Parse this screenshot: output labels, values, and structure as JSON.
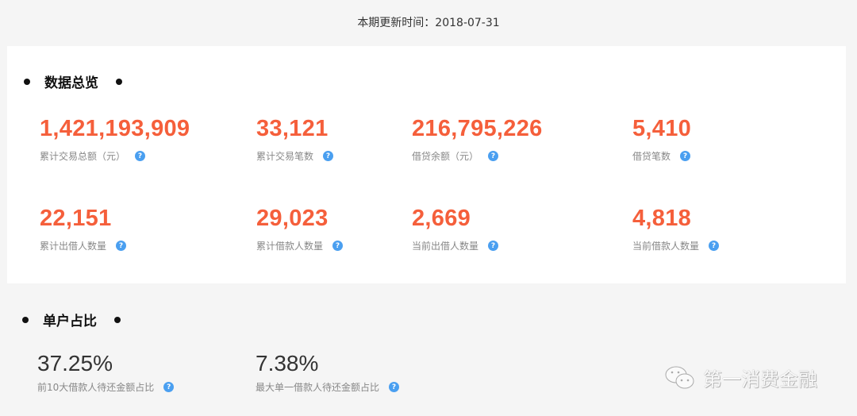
{
  "update": "本期更新时间：2018-07-31",
  "overview": {
    "title": "数据总览",
    "stats": [
      {
        "value": "1,421,193,909",
        "label": "累计交易总额（元）"
      },
      {
        "value": "33,121",
        "label": "累计交易笔数"
      },
      {
        "value": "216,795,226",
        "label": "借贷余额（元）"
      },
      {
        "value": "5,410",
        "label": "借贷笔数"
      },
      {
        "value": "22,151",
        "label": "累计出借人数量"
      },
      {
        "value": "29,023",
        "label": "累计借款人数量"
      },
      {
        "value": "2,669",
        "label": "当前出借人数量"
      },
      {
        "value": "4,818",
        "label": "当前借款人数量"
      }
    ]
  },
  "single": {
    "title": "单户占比",
    "stats": [
      {
        "value": "37.25%",
        "label": "前10大借款人待还金额占比"
      },
      {
        "value": "7.38%",
        "label": "最大单一借款人待还金额占比"
      }
    ]
  },
  "help_icon": "?",
  "watermark": "第一消费金融",
  "colors": {
    "accent": "#f55f3b",
    "help": "#4a9ff0"
  }
}
